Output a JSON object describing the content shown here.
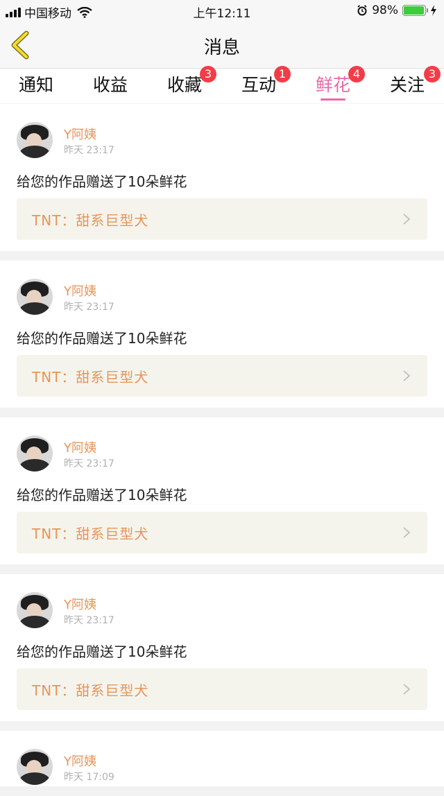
{
  "status_bar": {
    "carrier": "中国移动",
    "time": "上午12:11",
    "battery_percent": "98%",
    "battery_level": 0.98
  },
  "nav": {
    "title": "消息"
  },
  "tabs": [
    {
      "label": "通知",
      "badge": ""
    },
    {
      "label": "收益",
      "badge": ""
    },
    {
      "label": "收藏",
      "badge": "3"
    },
    {
      "label": "互动",
      "badge": "1"
    },
    {
      "label": "鲜花",
      "badge": "4"
    },
    {
      "label": "关注",
      "badge": "3"
    }
  ],
  "active_tab": "鲜花",
  "colors": {
    "accent_pink": "#e86aa6",
    "name_orange": "#e8945a",
    "badge_red": "#f23d48"
  },
  "messages": [
    {
      "user": "Y阿姨",
      "time": "昨天 23:17",
      "text": "给您的作品赠送了10朵鲜花",
      "work": "TNT：甜系巨型犬"
    },
    {
      "user": "Y阿姨",
      "time": "昨天 23:17",
      "text": "给您的作品赠送了10朵鲜花",
      "work": "TNT：甜系巨型犬"
    },
    {
      "user": "Y阿姨",
      "time": "昨天 23:17",
      "text": "给您的作品赠送了10朵鲜花",
      "work": "TNT：甜系巨型犬"
    },
    {
      "user": "Y阿姨",
      "time": "昨天 23:17",
      "text": "给您的作品赠送了10朵鲜花",
      "work": "TNT：甜系巨型犬"
    },
    {
      "user": "Y阿姨",
      "time": "昨天 17:09"
    }
  ]
}
